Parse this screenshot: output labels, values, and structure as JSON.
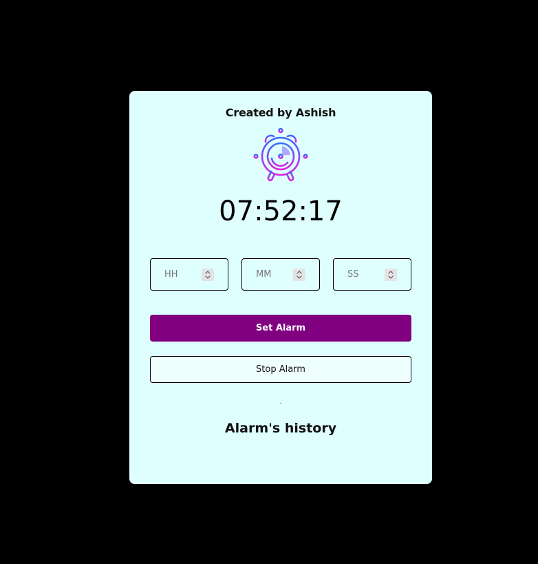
{
  "app": {
    "author_text": "Created by Ashish",
    "current_time": "07:52:17"
  },
  "alarm_form": {
    "hours_placeholder": "HH",
    "minutes_placeholder": "MM",
    "seconds_placeholder": "SS",
    "set_label": "Set Alarm",
    "stop_label": "Stop Alarm"
  },
  "history": {
    "separator": ".",
    "title": "Alarm's history",
    "entries": []
  },
  "icons": {
    "alarm_clock": "alarm-clock-icon",
    "spinner": "spinner-arrows-icon"
  },
  "colors": {
    "background": "#000000",
    "card": "#dffffe",
    "primary_button": "#810080",
    "icon_gradient_start": "#3b6cff",
    "icon_gradient_end": "#e020e0"
  }
}
